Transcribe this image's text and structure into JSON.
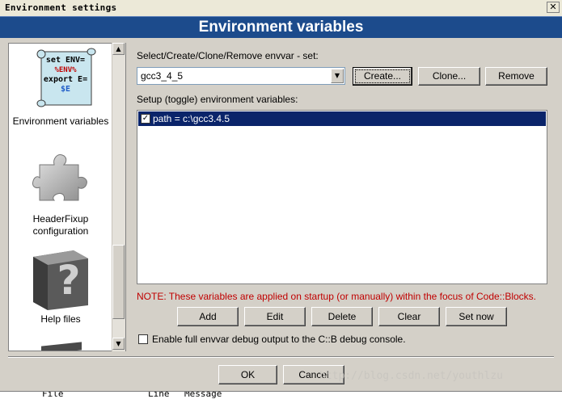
{
  "window": {
    "title": "Environment settings",
    "close_glyph": "✕"
  },
  "header": {
    "title": "Environment variables"
  },
  "sidebar": {
    "items": [
      {
        "label": "Environment variables",
        "icon": "env-script-icon",
        "icon_lines": [
          "set ENV=",
          "%ENV%",
          "export E=",
          "$E"
        ]
      },
      {
        "label_line1": "HeaderFixup",
        "label_line2": "configuration",
        "icon": "puzzle-icon"
      },
      {
        "label": "Help files",
        "icon": "help-book-icon"
      }
    ]
  },
  "envvar_set": {
    "label": "Select/Create/Clone/Remove envvar - set:",
    "selected": "gcc3_4_5",
    "create_label": "Create...",
    "clone_label": "Clone...",
    "remove_label": "Remove"
  },
  "vars": {
    "label": "Setup (toggle) environment variables:",
    "rows": [
      {
        "checked": true,
        "text": "path = c:\\gcc3.4.5"
      }
    ],
    "note": "NOTE: These variables are applied on startup (or manually) within the focus of Code::Blocks.",
    "add_label": "Add",
    "edit_label": "Edit",
    "delete_label": "Delete",
    "clear_label": "Clear",
    "setnow_label": "Set now"
  },
  "debug_option": {
    "checked": false,
    "label": "Enable full envvar debug output to the C::B debug console."
  },
  "dialog": {
    "ok_label": "OK",
    "cancel_label": "Cancel"
  },
  "watermark": "http://blog.csdn.net/youthlzu",
  "background_strip": {
    "col1": "File",
    "col2": "Line",
    "col3": "Message"
  },
  "colors": {
    "header_bg": "#1c4b8c",
    "selection_bg": "#0a246a",
    "note_text": "#c00000"
  }
}
